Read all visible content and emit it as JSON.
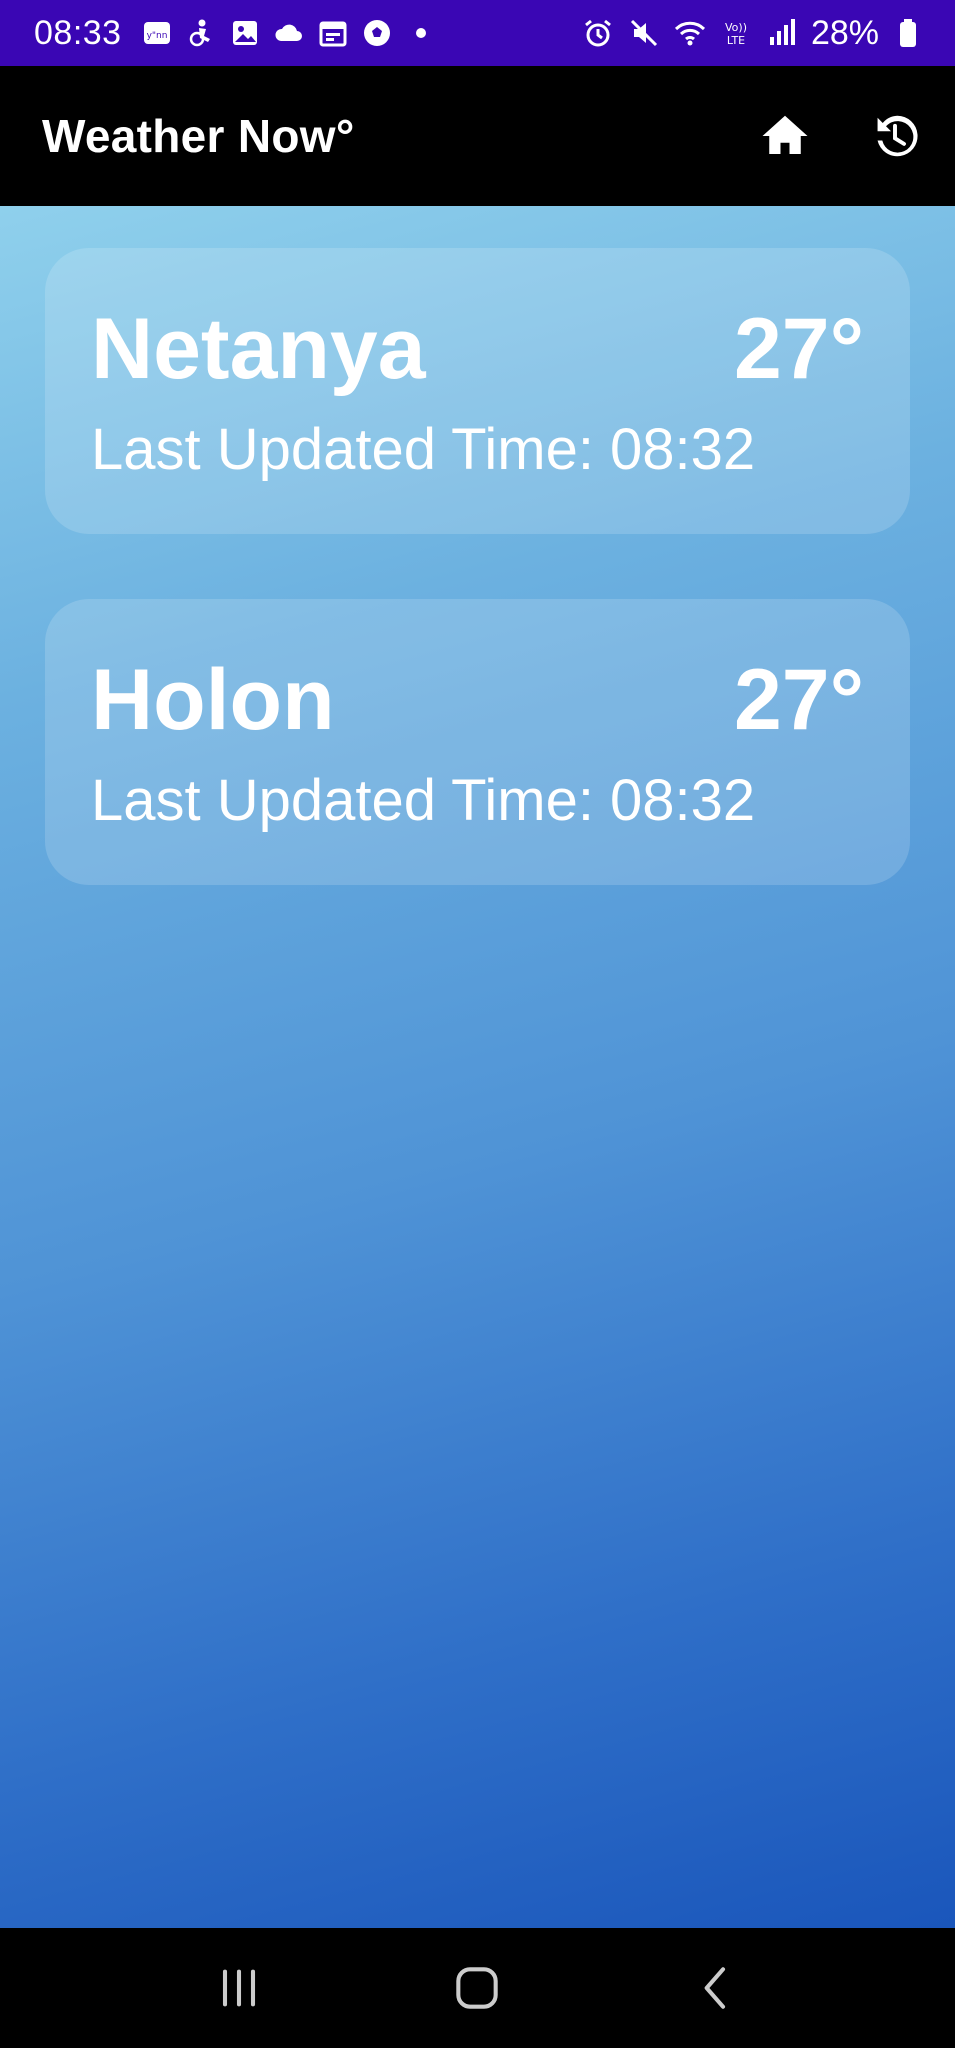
{
  "status_bar": {
    "time": "08:33",
    "battery_percent": "28%",
    "left_icons": [
      "news-icon",
      "accessibility-icon",
      "gallery-icon",
      "cloud-icon",
      "calendar-icon",
      "soccer-ball-icon",
      "dot-icon"
    ],
    "right_icons": [
      "alarm-icon",
      "mute-icon",
      "wifi-icon",
      "volte-icon",
      "signal-icon",
      "battery-icon"
    ],
    "lte_label": "LTE",
    "volte_label": "Vo))"
  },
  "app_bar": {
    "title": "Weather Now°",
    "actions": [
      "home-icon",
      "history-icon"
    ]
  },
  "cities": [
    {
      "name": "Netanya",
      "temperature": "27°",
      "updated_label": "Last Updated Time:",
      "updated_time": "08:32"
    },
    {
      "name": "Holon",
      "temperature": "27°",
      "updated_label": "Last Updated Time:",
      "updated_time": "08:32"
    }
  ],
  "nav_bar": {
    "buttons": [
      "recents-icon",
      "home-nav-icon",
      "back-icon"
    ]
  },
  "colors": {
    "status_bar_bg": "#3a06b4",
    "app_bar_bg": "#000000",
    "gradient_top": "#8fd0ec",
    "gradient_bottom": "#1a56bb",
    "text": "#ffffff"
  }
}
